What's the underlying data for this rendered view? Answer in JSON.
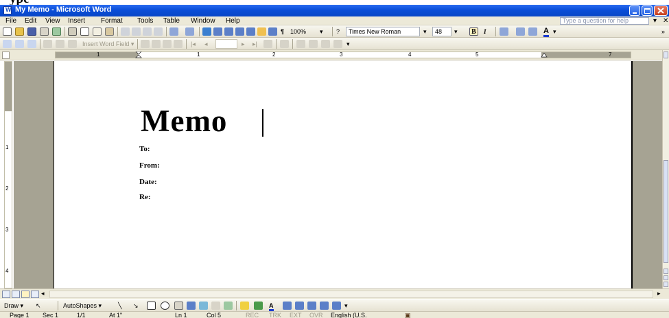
{
  "window": {
    "title": "My Memo - Microsoft Word",
    "cropped_caption": "ype"
  },
  "menubar": {
    "items": [
      "File",
      "Edit",
      "View",
      "Insert",
      "Format",
      "Tools",
      "Table",
      "Window",
      "Help"
    ],
    "help_box_placeholder": "Type a question for help"
  },
  "toolbar_standard": {
    "zoom": "100%",
    "font_name": "Times New Roman",
    "font_size": "48"
  },
  "toolbar_mailmerge": {
    "insert_word_field": "Insert Word Field ▾"
  },
  "ruler": {
    "numbers": [
      "1",
      "1",
      "2",
      "3",
      "4",
      "5",
      "7"
    ],
    "vertical_numbers": [
      "1",
      "2",
      "3",
      "4"
    ]
  },
  "document": {
    "heading": "Memo",
    "fields": [
      "To:",
      "From:",
      "Date:",
      "Re:"
    ]
  },
  "drawing_toolbar": {
    "draw": "Draw ▾",
    "autoshapes": "AutoShapes ▾"
  },
  "statusbar": {
    "page": "Page 1",
    "section": "Sec 1",
    "page_count": "1/1",
    "at": "At 1\"",
    "line": "Ln 1",
    "col": "Col 5",
    "rec": "REC",
    "trk": "TRK",
    "ext": "EXT",
    "ovr": "OVR",
    "language": "English (U.S."
  },
  "colors": {
    "titlebar": "#0a4ed8",
    "chrome": "#ece9d8",
    "ruler_margin": "#a6a393"
  }
}
